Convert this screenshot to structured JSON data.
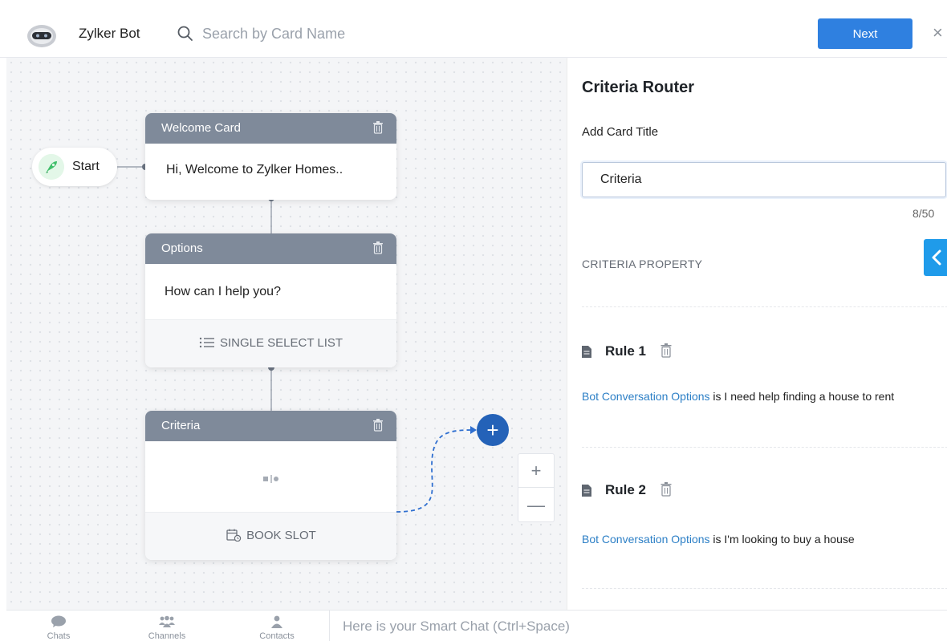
{
  "header": {
    "bot_name": "Zylker Bot",
    "search_placeholder": "Search by Card Name",
    "next_label": "Next",
    "close_glyph": "×"
  },
  "canvas": {
    "start_label": "Start",
    "cards": [
      {
        "header": "Welcome Card",
        "body": "Hi, Welcome to Zylker Homes.."
      },
      {
        "header": "Options",
        "body": "How can I help you?",
        "footer": "SINGLE SELECT LIST"
      },
      {
        "header": "Criteria",
        "body": "",
        "footer": "BOOK SLOT"
      }
    ],
    "add_glyph": "+",
    "zoom_in_glyph": "+",
    "zoom_out_glyph": "—"
  },
  "panel": {
    "title": "Criteria Router",
    "field_label": "Add Card Title",
    "title_value": "Criteria",
    "char_count": "8/50",
    "property_label": "CRITERIA PROPERTY",
    "rules": [
      {
        "title": "Rule 1",
        "field": "Bot Conversation Options",
        "condition": " is I need help finding a house to rent"
      },
      {
        "title": "Rule 2",
        "field": "Bot Conversation Options",
        "condition": " is I'm looking to buy a house"
      }
    ]
  },
  "bottom_bar": {
    "nav": [
      {
        "label": "Chats"
      },
      {
        "label": "Channels"
      },
      {
        "label": "Contacts"
      }
    ],
    "smart_chat_placeholder": "Here is your Smart Chat (Ctrl+Space)"
  },
  "colors": {
    "accent": "#2f80e0",
    "card_header": "#7f8a9a",
    "add_node": "#2462b8",
    "link": "#2c7fc6",
    "collapse_tab": "#1f9bea"
  }
}
